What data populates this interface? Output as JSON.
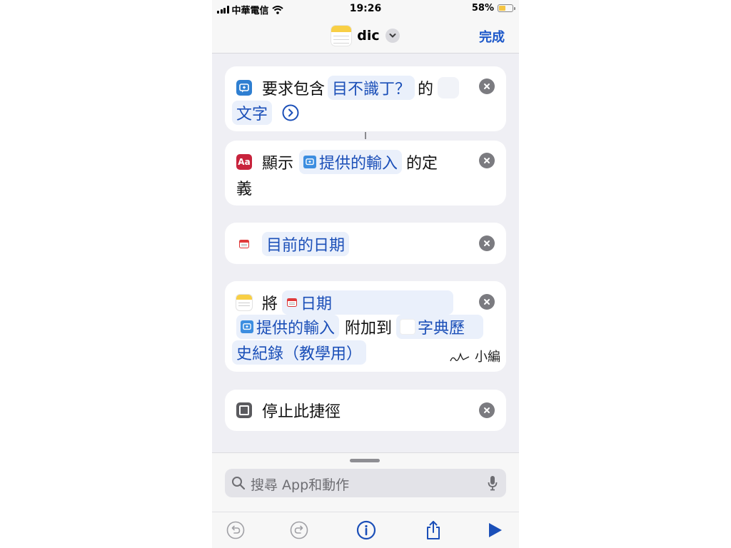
{
  "status_bar": {
    "carrier": "中華電信",
    "time": "19:26",
    "battery": "58%",
    "battery_level": 0.58
  },
  "nav": {
    "title": "dic",
    "done_label": "完成"
  },
  "actions": [
    {
      "prefix": "要求包含",
      "token": "目不識丁？",
      "suffix": "的",
      "line2_token": "文字"
    },
    {
      "prefix": "顯示",
      "token": "提供的輸入",
      "suffix": "的定",
      "line2": "義"
    },
    {
      "token": "目前的日期"
    },
    {
      "prefix": "將",
      "token1": "日期",
      "token2": "提供的輸入",
      "mid": "附加到",
      "token3a": "字典歷",
      "token3b": "史紀錄（教學用）",
      "watermark": "小編"
    },
    {
      "label": "停止此捷徑"
    }
  ],
  "search": {
    "placeholder": "搜尋 App和動作"
  },
  "colors": {
    "accent": "#1b4fb8",
    "token_bg": "#eaf0fb",
    "dictionary_red": "#c8233c",
    "notes_yellow": "#f8cf45"
  }
}
